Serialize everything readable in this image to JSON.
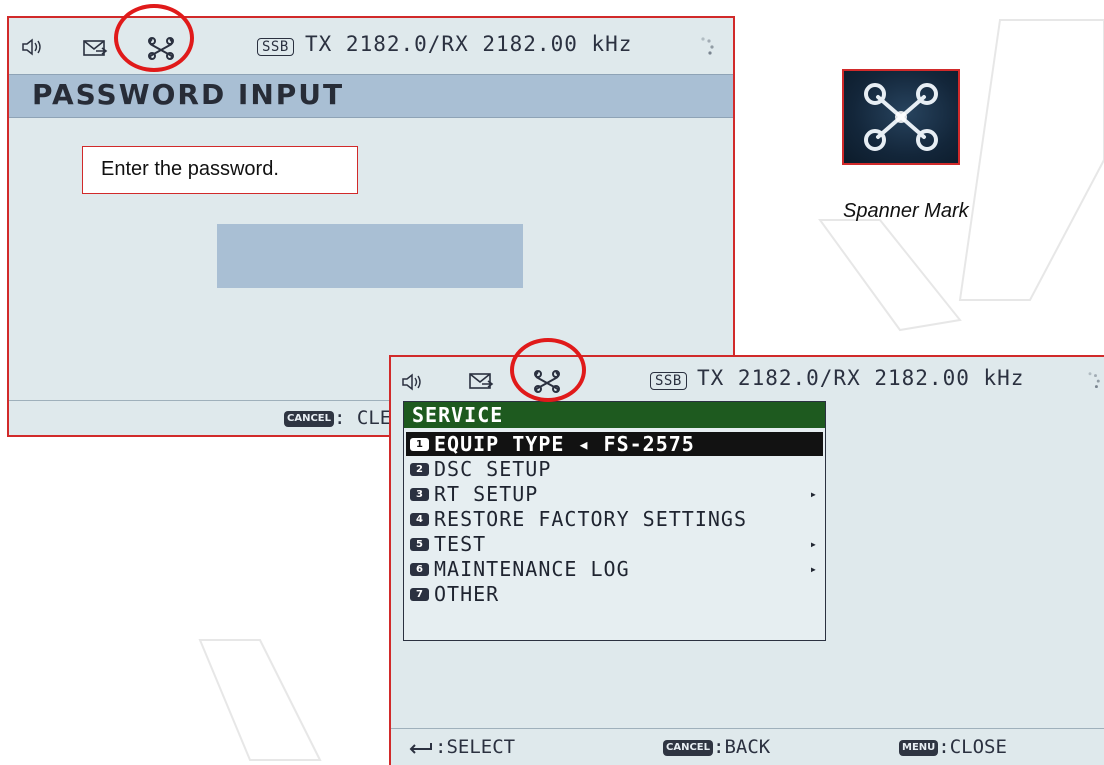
{
  "password_screen": {
    "status": {
      "mode_badge": "SSB",
      "frequency": "TX 2182.0/RX 2182.00 kHz"
    },
    "title": "PASSWORD INPUT",
    "callout": "Enter the password.",
    "password_value": "",
    "footer": {
      "cancel_key": "CANCEL",
      "cancel_label": ": CLE"
    }
  },
  "spanner_mark": {
    "caption": "Spanner Mark"
  },
  "service_screen": {
    "status": {
      "mode_badge": "SSB",
      "frequency": "TX 2182.0/RX 2182.00 kHz"
    },
    "menu_title": "SERVICE",
    "items": [
      {
        "num": "1",
        "label": "EQUIP TYPE ◂ FS-2575",
        "arrow": ""
      },
      {
        "num": "2",
        "label": "DSC SETUP",
        "arrow": ""
      },
      {
        "num": "3",
        "label": "RT SETUP",
        "arrow": "▸"
      },
      {
        "num": "4",
        "label": "RESTORE FACTORY SETTINGS",
        "arrow": ""
      },
      {
        "num": "5",
        "label": "TEST",
        "arrow": "▸"
      },
      {
        "num": "6",
        "label": "MAINTENANCE LOG",
        "arrow": "▸"
      },
      {
        "num": "7",
        "label": "OTHER",
        "arrow": ""
      }
    ],
    "selected_index": 1,
    "footer": {
      "select_label": ":SELECT",
      "cancel_key": "CANCEL",
      "back_label": ":BACK",
      "menu_key": "MENU",
      "close_label": ":CLOSE"
    }
  },
  "icons": [
    "speaker-icon",
    "message-icon",
    "spanner-icon",
    "busy-spinner-icon",
    "enter-key-icon"
  ],
  "colors": {
    "highlight_circle": "#e01a1a",
    "screen_bg": "#dfe9ec",
    "title_bar": "#a9bfd4",
    "menu_header": "#1e5a1f",
    "selected_row": "#121212"
  }
}
